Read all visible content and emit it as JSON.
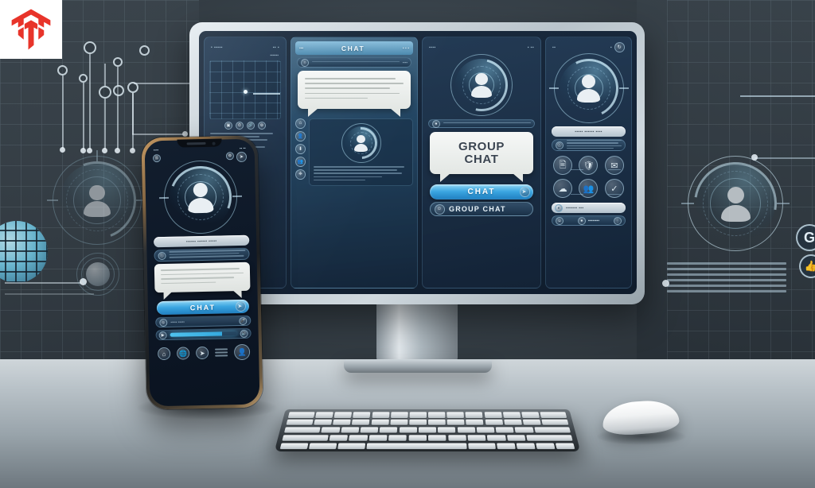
{
  "scene": {
    "title": "Group Chat App Concept — Desktop Monitor, Smartphone, Keyboard and Mouse on Desk"
  },
  "watermark": {
    "name": "brand-logo-mark",
    "alt": "Red angular hexagonal arrow logo"
  },
  "colors": {
    "accent_blue": "#3aa5e0",
    "accent_cyan": "#4fc3ee",
    "logo_red": "#e8342a",
    "screen_bg": "#16263a",
    "bubble_bg": "#eef1ee",
    "desk": "#b9c2c8"
  },
  "monitor": {
    "panels": [
      {
        "id": "analytics",
        "header_left": "• ▪▪▪▪▪",
        "header_right": "▪▪ ▪",
        "subtext": "▪▪▪▪▪▪",
        "chart": {
          "type": "scatter",
          "point_label": "●"
        },
        "icons": [
          "image-icon",
          "clock-icon",
          "link-icon",
          "settings-icon"
        ]
      },
      {
        "id": "chat",
        "title": "CHAT",
        "header_left_glyph": "▪▪▪",
        "header_right_glyph": "▪ ▪ ▪",
        "search_placeholder": "▪▪▪▪",
        "message_lines": 5,
        "sidebar_icons": [
          "home-icon",
          "person-icon",
          "download-icon",
          "group-icon",
          "network-icon"
        ],
        "profile_text_lines": 5
      },
      {
        "id": "group-chat",
        "header_left_glyph": "▪▪▪▪",
        "header_right_glyph": "▪ ▪▪",
        "bubble_line_1": "GROUP",
        "bubble_line_2": "CHAT",
        "chat_button_label": "CHAT",
        "chat_button_icon": "send-icon",
        "group_button_label": "GROUP CHAT",
        "group_button_icon": "group-icon"
      },
      {
        "id": "contact",
        "header_left_glyph": "▪▪",
        "header_right_glyph": "▪",
        "name_pill": "▪▪▪▪▪ ▪▪▪▪▪▪ ▪▪▪▪",
        "detail_lines": 4,
        "action_icons": [
          "document-icon",
          "shield-icon",
          "mail-icon",
          "cloud-icon",
          "users-icon",
          "shield-check-icon"
        ],
        "status_pill": "▪▪▪▪▪▪▪ ▪▪▪",
        "bottom_pill": "▪▪▪▪▪▪▪▪"
      }
    ]
  },
  "phone": {
    "status_left": "▪▪▪▪",
    "status_right": "▪▪ ▪▪",
    "sub_left_icon": "menu-icon",
    "sub_right_icons": [
      "settings-icon",
      "send-icon"
    ],
    "name_pill": "▪▪▪▪▪▪ ▪▪▪▪▪▪ ▪▪▪▪▪",
    "info_lines": 3,
    "message_lines": 4,
    "chat_button_label": "CHAT",
    "chat_button_icon": "send-icon",
    "input_placeholder": "▪▪▪▪▪ ▪▪▪▪▪",
    "input_left_icon": "emoji-icon",
    "input_right_icon": "mic-icon",
    "progress_percent": 78,
    "dock_icons": [
      "home-icon",
      "globe-icon",
      "send-icon",
      "menu-icon",
      "avatar-icon"
    ]
  },
  "background": {
    "left": {
      "node_graph_label": "network-node-graph",
      "globe_label": "globe-wireframe",
      "avatar_label": "avatar-hud-ring",
      "orb_label": "orb-icon"
    },
    "right": {
      "avatar_label": "avatar-hud-ring",
      "text_lines": 6,
      "edge_icons": [
        "g-badge-icon",
        "thumb-icon"
      ]
    }
  },
  "desk": {
    "keyboard_label": "wireless-keyboard",
    "mouse_label": "wireless-mouse",
    "stand_label": "monitor-stand"
  }
}
